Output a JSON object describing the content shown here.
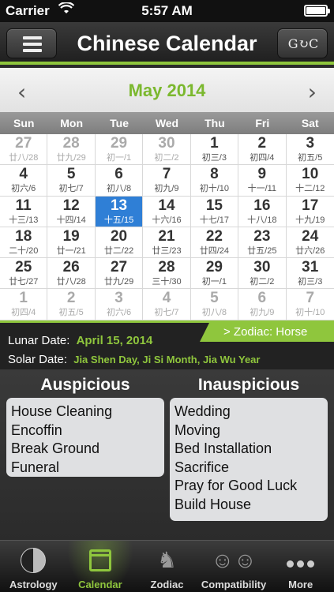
{
  "status_bar": {
    "carrier": "Carrier",
    "time": "5:57 AM"
  },
  "nav": {
    "title": "Chinese Calendar",
    "convert_label": "G↻C"
  },
  "calendar": {
    "month_title": "May 2014",
    "prev_arrow": "‹",
    "next_arrow": "›",
    "weekdays": [
      "Sun",
      "Mon",
      "Tue",
      "Wed",
      "Thu",
      "Fri",
      "Sat"
    ],
    "weeks": [
      [
        {
          "solar": "27",
          "lunar": "廿八/28",
          "muted": true
        },
        {
          "solar": "28",
          "lunar": "廿九/29",
          "muted": true
        },
        {
          "solar": "29",
          "lunar": "初一/1",
          "muted": true
        },
        {
          "solar": "30",
          "lunar": "初二/2",
          "muted": true
        },
        {
          "solar": "1",
          "lunar": "初三/3"
        },
        {
          "solar": "2",
          "lunar": "初四/4"
        },
        {
          "solar": "3",
          "lunar": "初五/5"
        }
      ],
      [
        {
          "solar": "4",
          "lunar": "初六/6"
        },
        {
          "solar": "5",
          "lunar": "初七/7"
        },
        {
          "solar": "6",
          "lunar": "初八/8"
        },
        {
          "solar": "7",
          "lunar": "初九/9"
        },
        {
          "solar": "8",
          "lunar": "初十/10"
        },
        {
          "solar": "9",
          "lunar": "十一/11"
        },
        {
          "solar": "10",
          "lunar": "十二/12"
        }
      ],
      [
        {
          "solar": "11",
          "lunar": "十三/13"
        },
        {
          "solar": "12",
          "lunar": "十四/14"
        },
        {
          "solar": "13",
          "lunar": "十五/15",
          "selected": true
        },
        {
          "solar": "14",
          "lunar": "十六/16"
        },
        {
          "solar": "15",
          "lunar": "十七/17"
        },
        {
          "solar": "16",
          "lunar": "十八/18"
        },
        {
          "solar": "17",
          "lunar": "十九/19"
        }
      ],
      [
        {
          "solar": "18",
          "lunar": "二十/20"
        },
        {
          "solar": "19",
          "lunar": "廿一/21"
        },
        {
          "solar": "20",
          "lunar": "廿二/22"
        },
        {
          "solar": "21",
          "lunar": "廿三/23"
        },
        {
          "solar": "22",
          "lunar": "廿四/24"
        },
        {
          "solar": "23",
          "lunar": "廿五/25"
        },
        {
          "solar": "24",
          "lunar": "廿六/26"
        }
      ],
      [
        {
          "solar": "25",
          "lunar": "廿七/27"
        },
        {
          "solar": "26",
          "lunar": "廿八/28"
        },
        {
          "solar": "27",
          "lunar": "廿九/29"
        },
        {
          "solar": "28",
          "lunar": "三十/30"
        },
        {
          "solar": "29",
          "lunar": "初一/1"
        },
        {
          "solar": "30",
          "lunar": "初二/2"
        },
        {
          "solar": "31",
          "lunar": "初三/3"
        }
      ],
      [
        {
          "solar": "1",
          "lunar": "初四/4",
          "muted": true
        },
        {
          "solar": "2",
          "lunar": "初五/5",
          "muted": true
        },
        {
          "solar": "3",
          "lunar": "初六/6",
          "muted": true
        },
        {
          "solar": "4",
          "lunar": "初七/7",
          "muted": true
        },
        {
          "solar": "5",
          "lunar": "初八/8",
          "muted": true
        },
        {
          "solar": "6",
          "lunar": "初九/9",
          "muted": true
        },
        {
          "solar": "7",
          "lunar": "初十/10",
          "muted": true
        }
      ]
    ]
  },
  "info": {
    "lunar_label": "Lunar Date:",
    "lunar_value": "April 15, 2014",
    "solar_label": "Solar Date:",
    "solar_value": "Jia Shen Day, Ji Si Month, Jia Wu Year",
    "zodiac": "> Zodiac: Horse"
  },
  "auspicious": {
    "title": "Auspicious",
    "items": [
      "House Cleaning",
      "Encoffin",
      "Break Ground",
      "Funeral"
    ]
  },
  "inauspicious": {
    "title": "Inauspicious",
    "items": [
      "Wedding",
      "Moving",
      "Bed Installation",
      "Sacrifice",
      "Pray for Good Luck",
      "Build House"
    ]
  },
  "tabs": [
    {
      "label": "Astrology",
      "icon": "yin-yang-icon"
    },
    {
      "label": "Calendar",
      "icon": "calendar-icon",
      "active": true
    },
    {
      "label": "Zodiac",
      "icon": "horse-icon"
    },
    {
      "label": "Compatibility",
      "icon": "couple-icon"
    },
    {
      "label": "More",
      "icon": "more-dots-icon"
    }
  ],
  "colors": {
    "accent": "#8fc63d",
    "selected": "#2f7fd6"
  }
}
